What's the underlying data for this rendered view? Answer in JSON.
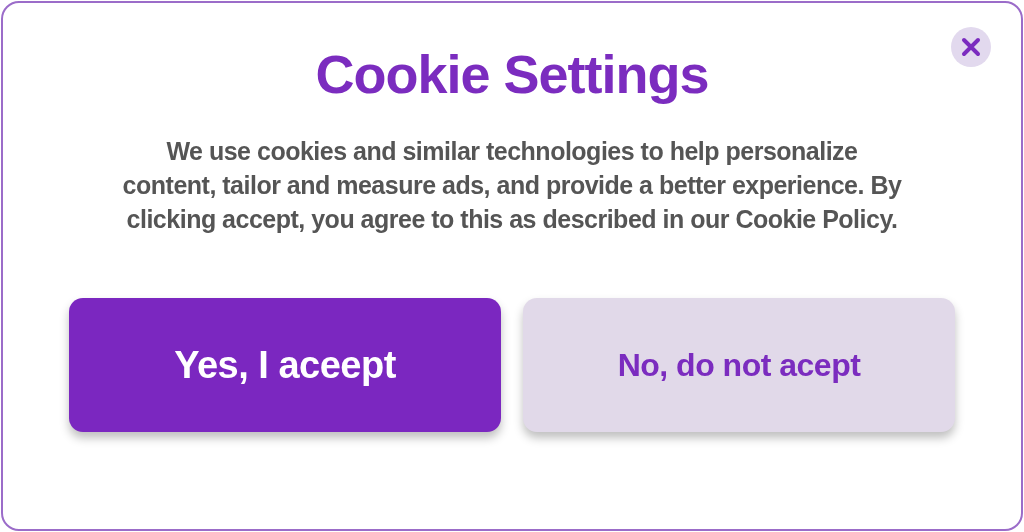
{
  "dialog": {
    "title": "Cookie Settings",
    "message": "We use cookies and similar technologies to help personalize content, tailor and measure ads, and provide a better experience. By clicking accept, you agree to this as described in our Cookie Policy.",
    "close_button": {
      "kind": "close"
    },
    "buttons": [
      {
        "label": "Yes, I aceept",
        "kind": "primary"
      },
      {
        "label": "No, do not acept",
        "kind": "secondary"
      }
    ]
  }
}
